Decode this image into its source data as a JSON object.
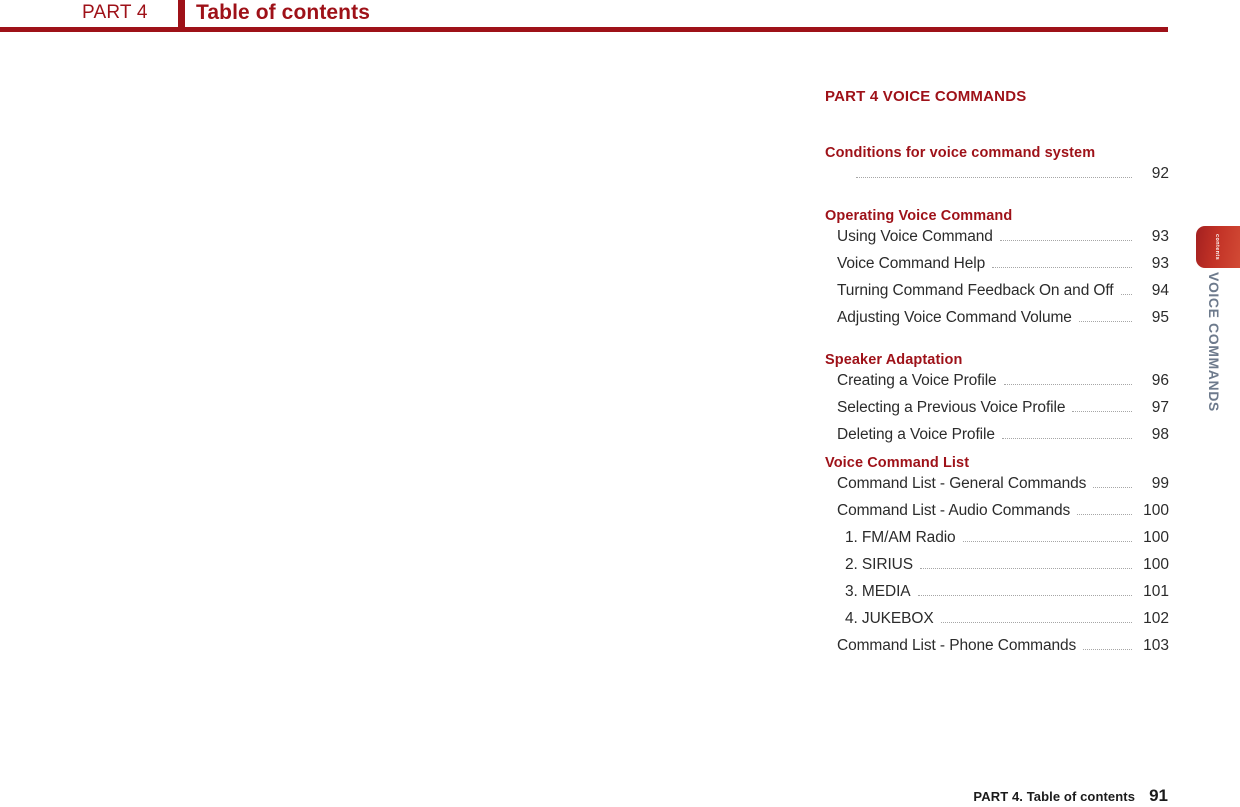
{
  "header": {
    "part_label": "PART 4",
    "title": "Table of contents"
  },
  "side_tabs": {
    "active_tab_label": "contents",
    "part_vertical_label": "VOICE COMMANDS"
  },
  "toc": {
    "part_title": "PART 4   VOICE COMMANDS",
    "sections": [
      {
        "heading": "Conditions for voice command system",
        "entries": [
          {
            "label": "",
            "page": "92"
          }
        ]
      },
      {
        "heading": "Operating Voice Command",
        "entries": [
          {
            "label": "Using Voice Command",
            "page": "93"
          },
          {
            "label": "Voice Command Help",
            "page": "93"
          },
          {
            "label": "Turning Command Feedback On and Off",
            "page": "94"
          },
          {
            "label": "Adjusting Voice Command Volume",
            "page": "95"
          }
        ]
      },
      {
        "heading": "Speaker Adaptation",
        "entries": [
          {
            "label": "Creating a Voice Profile",
            "page": "96"
          },
          {
            "label": "Selecting a Previous Voice Profile",
            "page": "97"
          },
          {
            "label": "Deleting a Voice Profile",
            "page": "98"
          }
        ]
      },
      {
        "heading": "Voice Command List",
        "entries": [
          {
            "label": "Command List - General Commands",
            "page": "99"
          },
          {
            "label": "Command List - Audio Commands",
            "page": "100"
          },
          {
            "label": "1. FM/AM Radio",
            "page": "100",
            "indent": true
          },
          {
            "label": "2. SIRIUS",
            "page": "100",
            "indent": true
          },
          {
            "label": "3. MEDIA",
            "page": "101",
            "indent": true
          },
          {
            "label": "4. JUKEBOX",
            "page": "102",
            "indent": true
          },
          {
            "label": "Command List - Phone Commands",
            "page": "103"
          }
        ]
      }
    ]
  },
  "footer": {
    "text": "PART 4. Table of contents",
    "page": "91"
  },
  "colors": {
    "brand_red": "#9e1118",
    "tab_red": "#c23226",
    "vertical_label_gray": "#6d7a8c",
    "body_text": "#2b2b2b"
  }
}
